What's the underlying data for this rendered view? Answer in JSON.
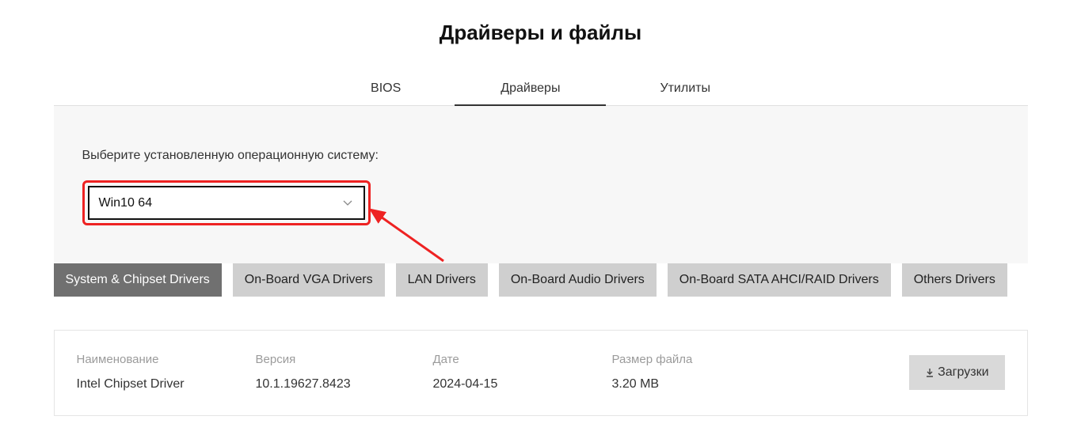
{
  "page_title": "Драйверы и файлы",
  "tabs": {
    "items": [
      "BIOS",
      "Драйверы",
      "Утилиты"
    ],
    "active_index": 1
  },
  "os_selector": {
    "label": "Выберите установленную операционную систему:",
    "selected": "Win10 64"
  },
  "categories": {
    "items": [
      "System & Chipset Drivers",
      "On-Board VGA Drivers",
      "LAN Drivers",
      "On-Board Audio Drivers",
      "On-Board SATA AHCI/RAID Drivers",
      "Others Drivers"
    ],
    "active_index": 0
  },
  "driver": {
    "labels": {
      "name": "Наименование",
      "version": "Версия",
      "date": "Дате",
      "size": "Размер файла"
    },
    "name": "Intel Chipset Driver",
    "version": "10.1.19627.8423",
    "date": "2024-04-15",
    "size": "3.20 MB",
    "download_label": "Загрузки"
  }
}
